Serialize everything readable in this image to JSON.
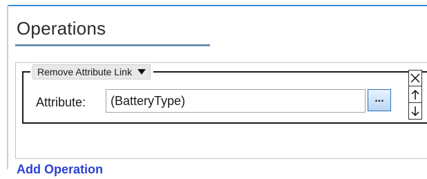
{
  "section": {
    "title": "Operations"
  },
  "operation": {
    "type_label": "Remove Attribute Link",
    "attribute_label": "Attribute:",
    "attribute_value": "(BatteryType)",
    "browse_label": "..."
  },
  "actions": {
    "add_operation": "Add Operation"
  },
  "icons": [
    "chevron-down-icon",
    "close-icon",
    "arrow-up-icon",
    "arrow-down-icon"
  ],
  "colors": {
    "accent": "#3b8ad6",
    "link": "#2c3fd1"
  }
}
